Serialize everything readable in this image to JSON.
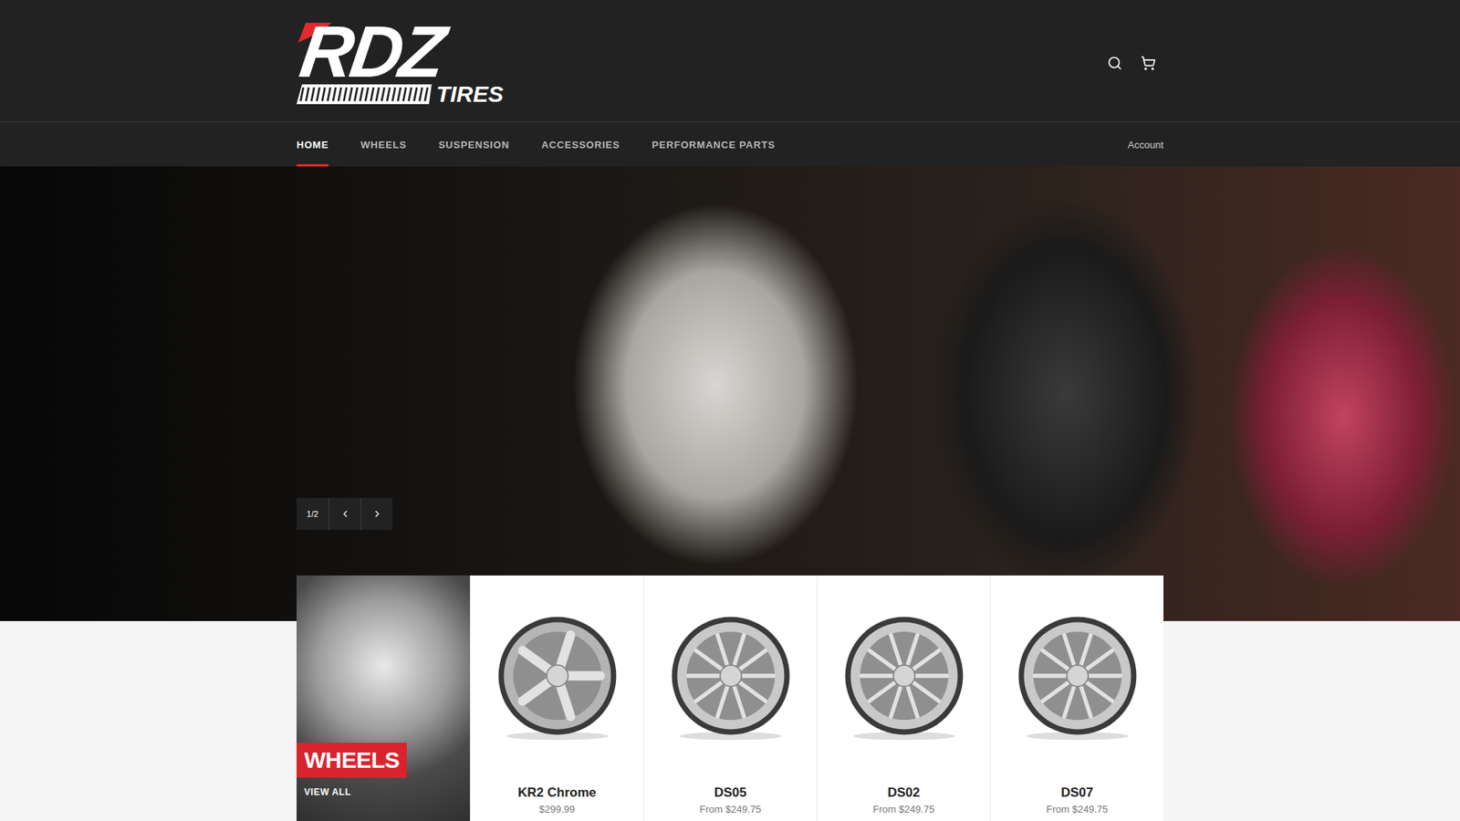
{
  "header": {
    "logo": {
      "primary": "RDZ",
      "secondary": "TIRES"
    }
  },
  "nav": {
    "items": [
      {
        "label": "HOME",
        "selected": true
      },
      {
        "label": "WHEELS",
        "selected": false
      },
      {
        "label": "SUSPENSION",
        "selected": false
      },
      {
        "label": "ACCESSORIES",
        "selected": false
      },
      {
        "label": "PERFORMANCE PARTS",
        "selected": false
      }
    ],
    "account": "Account"
  },
  "hero": {
    "slide": "1/2"
  },
  "collection": {
    "title": "WHEELS",
    "link": "VIEW ALL"
  },
  "products": [
    {
      "name": "KR2 Chrome",
      "price": "$299.99"
    },
    {
      "name": "DS05",
      "price": "From $249.75"
    },
    {
      "name": "DS02",
      "price": "From $249.75"
    },
    {
      "name": "DS07",
      "price": "From $249.75"
    }
  ]
}
